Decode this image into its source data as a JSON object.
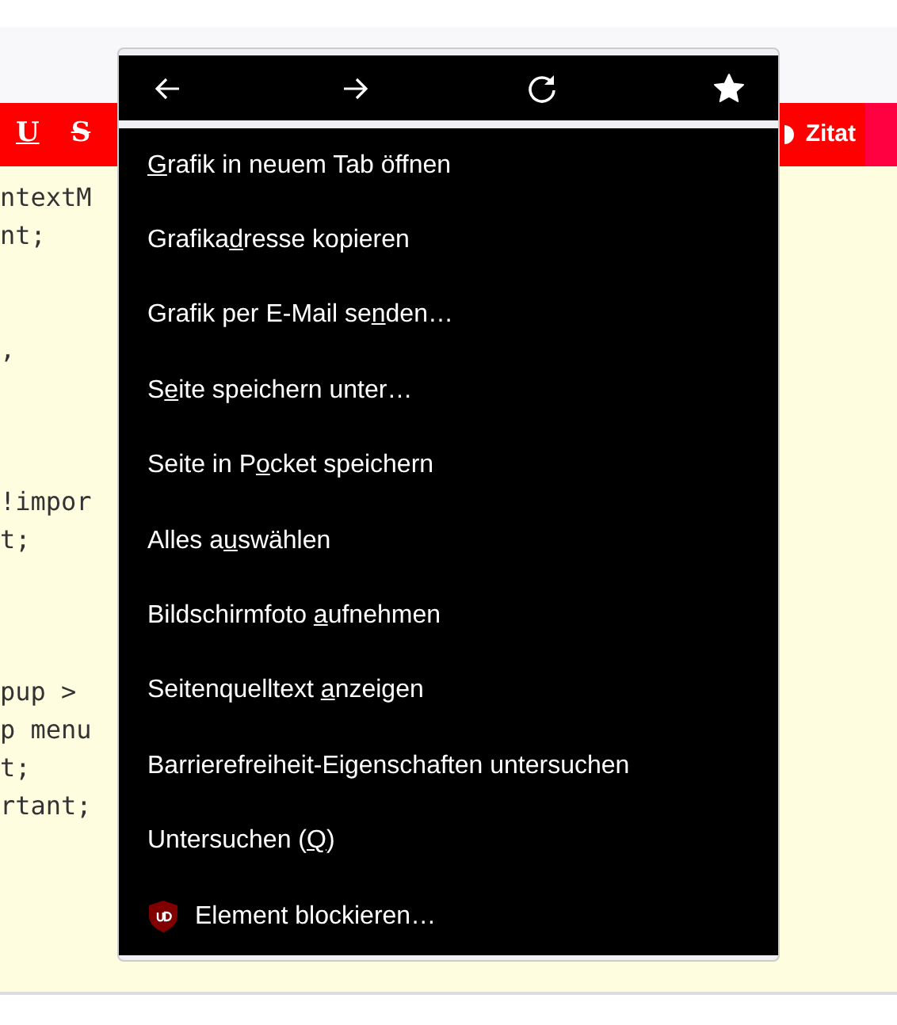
{
  "toolbar": {
    "left_buttons": [
      {
        "label": "U",
        "kind": "underline"
      },
      {
        "label": "S",
        "kind": "strike"
      }
    ],
    "quote_button": {
      "label": "Zitat"
    }
  },
  "code_lines": [
    {
      "kind": "text",
      "text": "ntextM"
    },
    {
      "kind": "text",
      "text": "nt;"
    },
    {
      "kind": "blank"
    },
    {
      "kind": "blank"
    },
    {
      "kind": "text",
      "text": ","
    },
    {
      "kind": "blank"
    },
    {
      "kind": "blank"
    },
    {
      "kind": "blank"
    },
    {
      "kind": "text",
      "text": "!impor"
    },
    {
      "kind": "text",
      "text": "t;"
    },
    {
      "kind": "blank"
    },
    {
      "kind": "blank"
    },
    {
      "kind": "blank"
    },
    {
      "kind": "text",
      "text": "pup >"
    },
    {
      "kind": "text",
      "text": "p menu"
    },
    {
      "kind": "text",
      "text": "t;"
    },
    {
      "kind": "text",
      "text": "rtant;"
    }
  ],
  "context_menu": {
    "nav_buttons": [
      {
        "kind": "back"
      },
      {
        "kind": "forward"
      },
      {
        "kind": "reload"
      },
      {
        "kind": "bookmark"
      }
    ],
    "items": [
      {
        "kind": "plain",
        "access_key": "G",
        "after": "rafik in neuem Tab öffnen"
      },
      {
        "kind": "plain",
        "before": "Grafika",
        "access_key": "d",
        "after": "resse kopieren"
      },
      {
        "kind": "plain",
        "before": "Grafik per E-Mail se",
        "access_key": "n",
        "after": "den…"
      },
      {
        "kind": "plain",
        "before": "S",
        "access_key": "e",
        "after": "ite speichern unter…"
      },
      {
        "kind": "plain",
        "before": "Seite in P",
        "access_key": "o",
        "after": "cket speichern"
      },
      {
        "kind": "plain",
        "before": "Alles a",
        "access_key": "u",
        "after": "swählen"
      },
      {
        "kind": "plain",
        "before": "Bildschirmfoto ",
        "access_key": "a",
        "after": "ufnehmen"
      },
      {
        "kind": "plain",
        "before": "Seitenquelltext ",
        "access_key": "a",
        "after": "nzeigen"
      },
      {
        "kind": "plain",
        "before": "Barrierefreiheit-Eigenschaften untersuchen"
      },
      {
        "kind": "plain",
        "before": "Untersuchen (",
        "access_key": "Q",
        "after": ")"
      },
      {
        "kind": "extension",
        "before": "Element blockieren…"
      }
    ]
  }
}
